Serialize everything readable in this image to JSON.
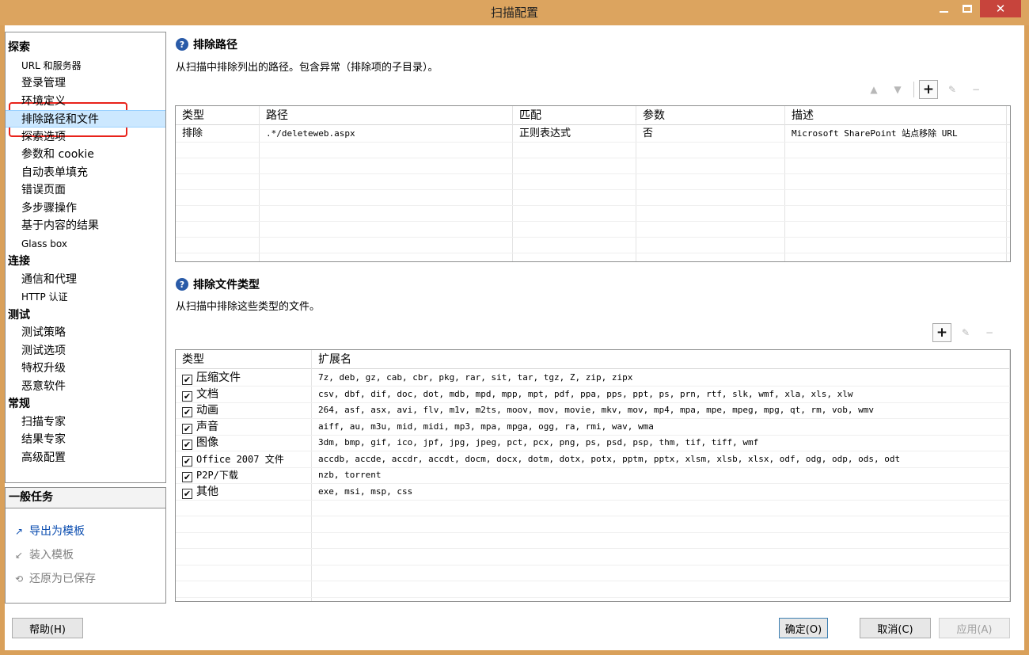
{
  "window": {
    "title": "扫描配置",
    "minimize_glyph": "—",
    "close_glyph": "✕"
  },
  "nav": {
    "items": [
      {
        "label": "探索",
        "kind": "cat"
      },
      {
        "label": "URL 和服务器",
        "kind": "item"
      },
      {
        "label": "登录管理",
        "kind": "item"
      },
      {
        "label": "环境定义",
        "kind": "item"
      },
      {
        "label": "排除路径和文件",
        "kind": "item",
        "selected": true
      },
      {
        "label": "探索选项",
        "kind": "item"
      },
      {
        "label": "参数和 cookie",
        "kind": "item"
      },
      {
        "label": "自动表单填充",
        "kind": "item"
      },
      {
        "label": "错误页面",
        "kind": "item"
      },
      {
        "label": "多步骤操作",
        "kind": "item"
      },
      {
        "label": "基于内容的结果",
        "kind": "item"
      },
      {
        "label": "Glass box",
        "kind": "item"
      },
      {
        "label": "连接",
        "kind": "cat"
      },
      {
        "label": "通信和代理",
        "kind": "item"
      },
      {
        "label": "HTTP 认证",
        "kind": "item"
      },
      {
        "label": "测试",
        "kind": "cat"
      },
      {
        "label": "测试策略",
        "kind": "item"
      },
      {
        "label": "测试选项",
        "kind": "item"
      },
      {
        "label": "特权升级",
        "kind": "item"
      },
      {
        "label": "恶意软件",
        "kind": "item"
      },
      {
        "label": "常规",
        "kind": "cat"
      },
      {
        "label": "扫描专家",
        "kind": "item"
      },
      {
        "label": "结果专家",
        "kind": "item"
      },
      {
        "label": "高级配置",
        "kind": "item"
      }
    ]
  },
  "tasks": {
    "header": "一般任务",
    "items": [
      {
        "label": "导出为模板",
        "icon": "export-icon",
        "glyph": "↗"
      },
      {
        "label": "装入模板",
        "icon": "import-icon",
        "glyph": "↙"
      },
      {
        "label": "还原为已保存",
        "icon": "restore-icon",
        "glyph": "⟲"
      }
    ]
  },
  "exclude_paths": {
    "title": "排除路径",
    "description": "从扫描中排除列出的路径。包含异常（排除项的子目录）。",
    "help_glyph": "?",
    "toolbar": {
      "move_up": "▲",
      "move_down": "▼",
      "add": "+",
      "edit": "✎",
      "remove": "−"
    },
    "columns": [
      "类型",
      "路径",
      "匹配",
      "参数",
      "描述"
    ],
    "rows": [
      {
        "type": "排除",
        "path": ".*/deleteweb.aspx",
        "match": "正则表达式",
        "params": "否",
        "description": "Microsoft SharePoint 站点移除 URL"
      }
    ]
  },
  "exclude_filetypes": {
    "title": "排除文件类型",
    "description": "从扫描中排除这些类型的文件。",
    "help_glyph": "?",
    "toolbar": {
      "add": "+",
      "edit": "✎",
      "remove": "−"
    },
    "columns": [
      "类型",
      "扩展名"
    ],
    "check_glyph": "✔",
    "rows": [
      {
        "type": "压缩文件",
        "checked": true,
        "extensions": "7z, deb, gz, cab, cbr, pkg, rar, sit, tar, tgz, Z, zip, zipx"
      },
      {
        "type": "文档",
        "checked": true,
        "extensions": "csv, dbf, dif, doc, dot, mdb, mpd, mpp, mpt, pdf, ppa, pps, ppt, ps, prn, rtf, slk, wmf, xla, xls, xlw"
      },
      {
        "type": "动画",
        "checked": true,
        "extensions": "264, asf, asx, avi, flv, m1v, m2ts, moov, mov, movie, mkv, mov, mp4, mpa, mpe, mpeg, mpg, qt, rm, vob, wmv"
      },
      {
        "type": "声音",
        "checked": true,
        "extensions": "aiff, au, m3u, mid, midi, mp3, mpa, mpga, ogg, ra, rmi, wav, wma"
      },
      {
        "type": "图像",
        "checked": true,
        "extensions": "3dm, bmp, gif, ico, jpf, jpg, jpeg, pct, pcx, png, ps, psd, psp, thm, tif, tiff, wmf"
      },
      {
        "type": "Office 2007 文件",
        "checked": true,
        "extensions": "accdb, accde, accdr, accdt, docm, docx, dotm, dotx, potx, pptm, pptx, xlsm, xlsb, xlsx, odf, odg, odp, ods, odt"
      },
      {
        "type": "P2P/下载",
        "checked": true,
        "extensions": "nzb, torrent"
      },
      {
        "type": "其他",
        "checked": true,
        "extensions": "exe, msi, msp, css"
      }
    ]
  },
  "footer": {
    "help": "帮助(H)",
    "ok": "确定(O)",
    "cancel": "取消(C)",
    "apply": "应用(A)"
  },
  "colors": {
    "title_bar": "#dca45f",
    "close_button": "#c7443c",
    "selection": "#cce8ff",
    "highlight_box": "#e8221a",
    "task_link": "#0b4db0"
  }
}
